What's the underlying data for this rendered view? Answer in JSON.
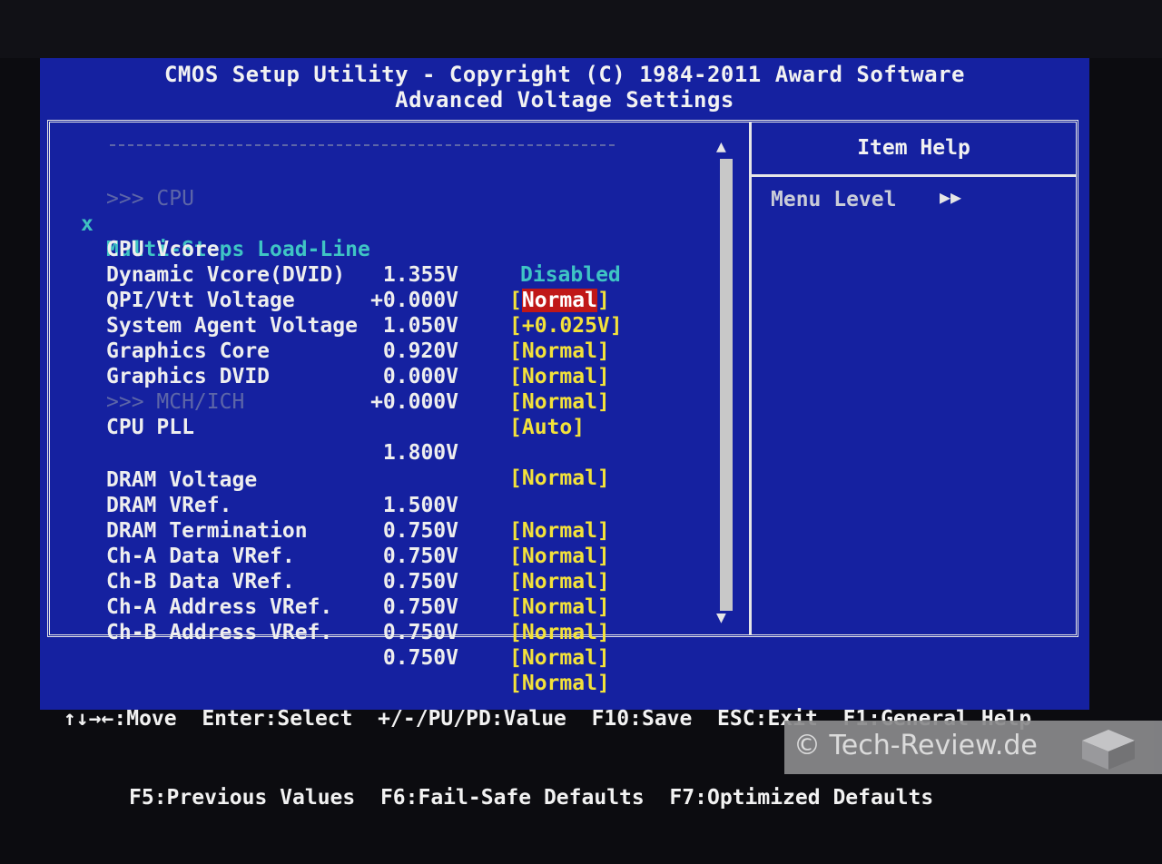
{
  "title": {
    "line1": "CMOS Setup Utility - Copyright (C) 1984-2011 Award Software",
    "line2": "Advanced Voltage Settings"
  },
  "sections": {
    "cpu": ">>> CPU",
    "mch": ">>> MCH/ICH"
  },
  "rows": [
    {
      "mark": "x",
      "name": "Multi-Steps Load-Line",
      "value": "",
      "option": "Disabled"
    },
    {
      "mark": "",
      "name": "CPU Vcore",
      "value": "1.355V",
      "option_prefix": "[",
      "option_selected": "Normal",
      "option_suffix": "]"
    },
    {
      "mark": "",
      "name": "Dynamic Vcore(DVID)",
      "value": "+0.000V",
      "option": "[+0.025V]"
    },
    {
      "mark": "",
      "name": "QPI/Vtt Voltage",
      "value": "1.050V",
      "option": "[Normal]"
    },
    {
      "mark": "",
      "name": "System Agent Voltage",
      "value": "0.920V",
      "option": "[Normal]"
    },
    {
      "mark": "",
      "name": "Graphics Core",
      "value": "0.000V",
      "option": "[Normal]"
    },
    {
      "mark": "",
      "name": "Graphics DVID",
      "value": "+0.000V",
      "option": "[Auto]"
    },
    {
      "mark": "",
      "name": "CPU PLL",
      "value": "1.800V",
      "option": "[Normal]"
    },
    {
      "mark": "",
      "name": "DRAM Voltage",
      "value": "1.500V",
      "option": "[Normal]"
    },
    {
      "mark": "",
      "name": "DRAM VRef.",
      "value": "0.750V",
      "option": "[Normal]"
    },
    {
      "mark": "",
      "name": "DRAM Termination",
      "value": "0.750V",
      "option": "[Normal]"
    },
    {
      "mark": "",
      "name": "Ch-A Data VRef.",
      "value": "0.750V",
      "option": "[Normal]"
    },
    {
      "mark": "",
      "name": "Ch-B Data VRef.",
      "value": "0.750V",
      "option": "[Normal]"
    },
    {
      "mark": "",
      "name": "Ch-A Address VRef.",
      "value": "0.750V",
      "option": "[Normal]"
    },
    {
      "mark": "",
      "name": "Ch-B Address VRef.",
      "value": "0.750V",
      "option": "[Normal]"
    }
  ],
  "help": {
    "title": "Item Help",
    "menu_level": "Menu Level",
    "arrow": "▶▶"
  },
  "footer": {
    "line1": "↑↓→←:Move  Enter:Select  +/-/PU/PD:Value  F10:Save  ESC:Exit  F1:General Help",
    "line2": "F5:Previous Values  F6:Fail-Safe Defaults  F7:Optimized Defaults"
  },
  "watermark": "© Tech-Review.de",
  "colors": {
    "bios_blue": "#1521a0",
    "option_yellow": "#f3e23a",
    "selected_red": "#c01818",
    "cyan": "#3fc4c4"
  }
}
